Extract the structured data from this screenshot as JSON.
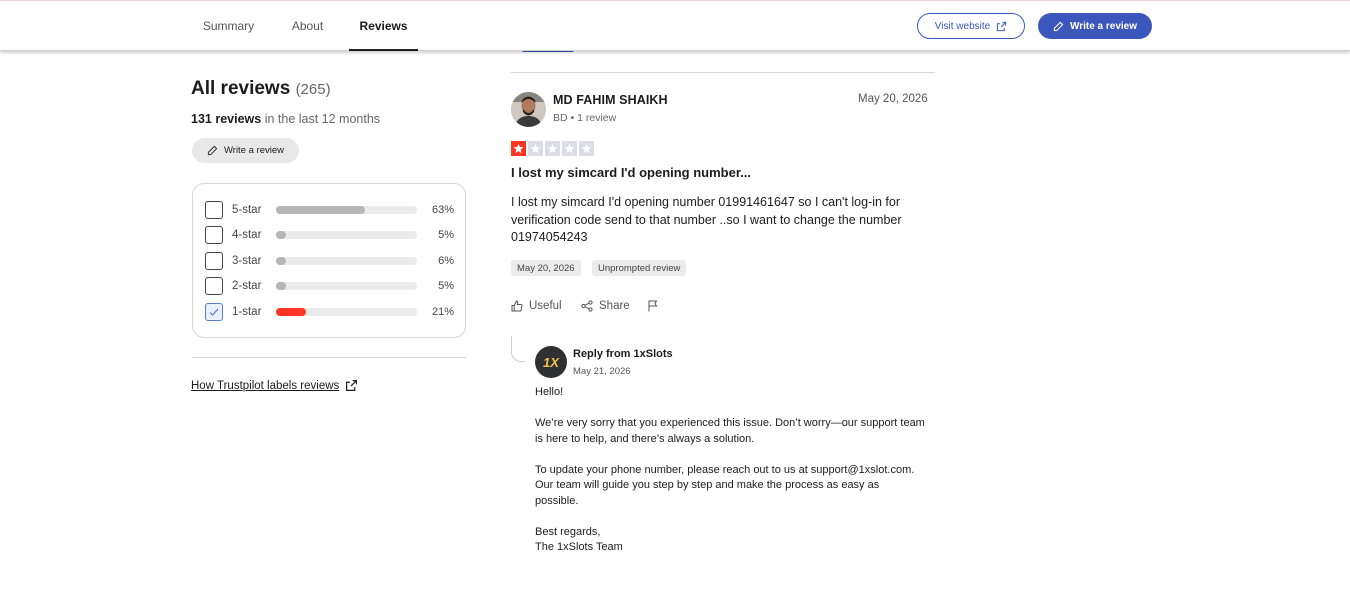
{
  "nav": {
    "tabs": [
      {
        "label": "Summary"
      },
      {
        "label": "About"
      },
      {
        "label": "Reviews",
        "active": true
      }
    ],
    "visit_website": "Visit website",
    "write_review": "Write a review"
  },
  "sidebar": {
    "title": "All reviews",
    "count": "(265)",
    "recent_count": "131 reviews",
    "recent_suffix": "in the last 12 months",
    "write_review": "Write a review",
    "distribution": [
      {
        "label": "5-star",
        "percent": "63%",
        "fraction": 0.63,
        "checked": false
      },
      {
        "label": "4-star",
        "percent": "5%",
        "fraction": 0.05,
        "checked": false
      },
      {
        "label": "3-star",
        "percent": "6%",
        "fraction": 0.06,
        "checked": false
      },
      {
        "label": "2-star",
        "percent": "5%",
        "fraction": 0.05,
        "checked": false
      },
      {
        "label": "1-star",
        "percent": "21%",
        "fraction": 0.21,
        "checked": true
      }
    ],
    "labels_link": "How Trustpilot labels reviews"
  },
  "review": {
    "author": "MD FAHIM SHAIKH",
    "meta": "BD • 1 review",
    "date": "May 20, 2026",
    "rating": 1,
    "title": "I lost my simcard I'd opening number...",
    "body": "I lost my simcard I'd opening number 01991461647 so I can't log-in for verification code send to that number ..so I want to change the number 01974054243",
    "tags": [
      "May 20, 2026",
      "Unprompted review"
    ],
    "actions": {
      "useful": "Useful",
      "share": "Share"
    }
  },
  "reply": {
    "from": "Reply from 1xSlots",
    "logo_text": "1X",
    "date": "May 21, 2026",
    "paragraphs": [
      "Hello!",
      "We’re very sorry that you experienced this issue. Don’t worry—our support team is here to help, and there’s always a solution.",
      "To update your phone number, please reach out to us at support@1xslot.com. Our team will guide you step by step and make the process as easy as possible.",
      "Best regards,"
    ],
    "signature": "The 1xSlots Team"
  },
  "colors": {
    "brand_blue": "#3c57bc",
    "one_star_red": "#ff3722",
    "bar_gray": "#b6b6b6"
  }
}
